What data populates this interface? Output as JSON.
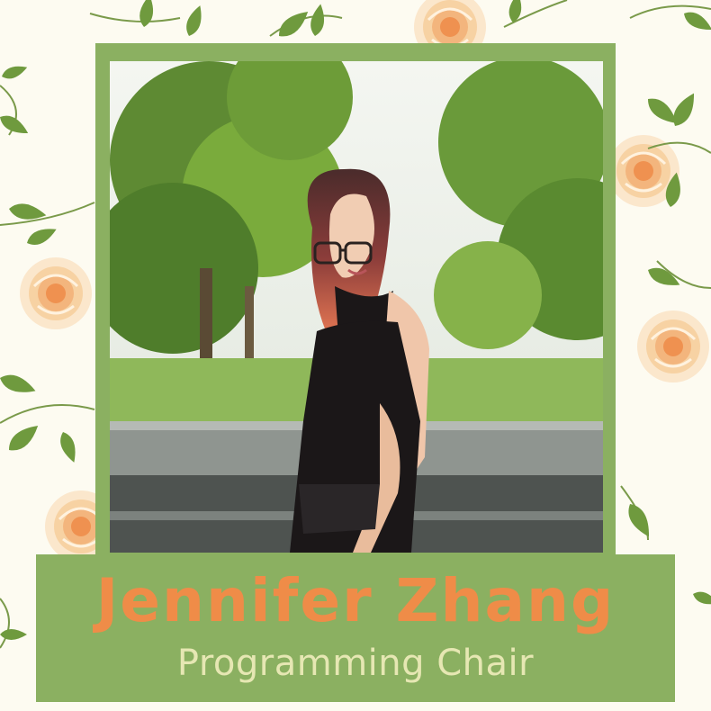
{
  "card": {
    "name": "Jennifer Zhang",
    "role": "Programming Chair"
  },
  "icons": [
    "rose-icon",
    "leaf-icon"
  ],
  "colors": {
    "background": "#fdfbf1",
    "frame_green": "#8bb061",
    "name_orange": "#ef8c48",
    "role_cream": "#e6e7b3",
    "rose_peach": "#f6d3a6",
    "leaf_green": "#6f9a3e"
  }
}
